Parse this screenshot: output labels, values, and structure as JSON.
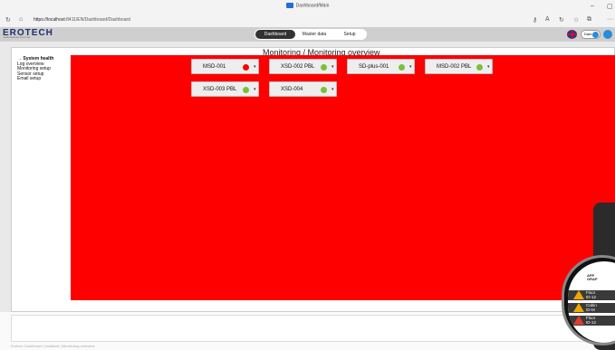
{
  "browser": {
    "tab_title": "Dashboard/Main",
    "url_host": "https://localhost",
    "url_path": ":8411/EN/Dashboard/Dashboard"
  },
  "app": {
    "logo": "EROTECH",
    "logo_subtitle": "ENVIRONMENTAL SOLUTIONS",
    "nav_tabs": [
      "Dashboard",
      "Master data",
      "Setup"
    ],
    "active_tab": "Dashboard",
    "dark_label": "Dark"
  },
  "sidebar": {
    "items": [
      {
        "label": "→ System health",
        "active": true
      },
      {
        "label": "Log overview",
        "active": false
      },
      {
        "label": "Monitoring setup",
        "active": false
      },
      {
        "label": "Sensor setup",
        "active": false
      },
      {
        "label": "Email setup",
        "active": false
      }
    ]
  },
  "page": {
    "title": "Monitoring / Monitoring overview",
    "alarm_color": "#ff0000"
  },
  "devices": [
    {
      "name": "MSD-001",
      "status": "alarm",
      "status_color": "#ff0000"
    },
    {
      "name": "XSD-002 PBL",
      "status": "ok",
      "status_color": "#7cbf3a"
    },
    {
      "name": "SD-plus-001",
      "status": "ok",
      "status_color": "#7cbf3a"
    },
    {
      "name": "MSD-002 PBL",
      "status": "ok",
      "status_color": "#7cbf3a"
    },
    {
      "name": "XSD-003 PBL",
      "status": "ok",
      "status_color": "#7cbf3a"
    },
    {
      "name": "XSD-004",
      "status": "ok",
      "status_color": "#7cbf3a"
    }
  ],
  "status_bar": "Erotech Dashboard | localhost | Monitoring overview",
  "watch": {
    "brand_line1": "APP",
    "brand_line2": "GRAP",
    "alerts": [
      {
        "line1": "Floor",
        "line2": "ID-12",
        "color": "#f2a600"
      },
      {
        "line1": "Cabin",
        "line2": "ID-M",
        "color": "#f2a600"
      },
      {
        "line1": "Floor",
        "line2": "ID-12",
        "color": "#e23b2a"
      }
    ]
  }
}
